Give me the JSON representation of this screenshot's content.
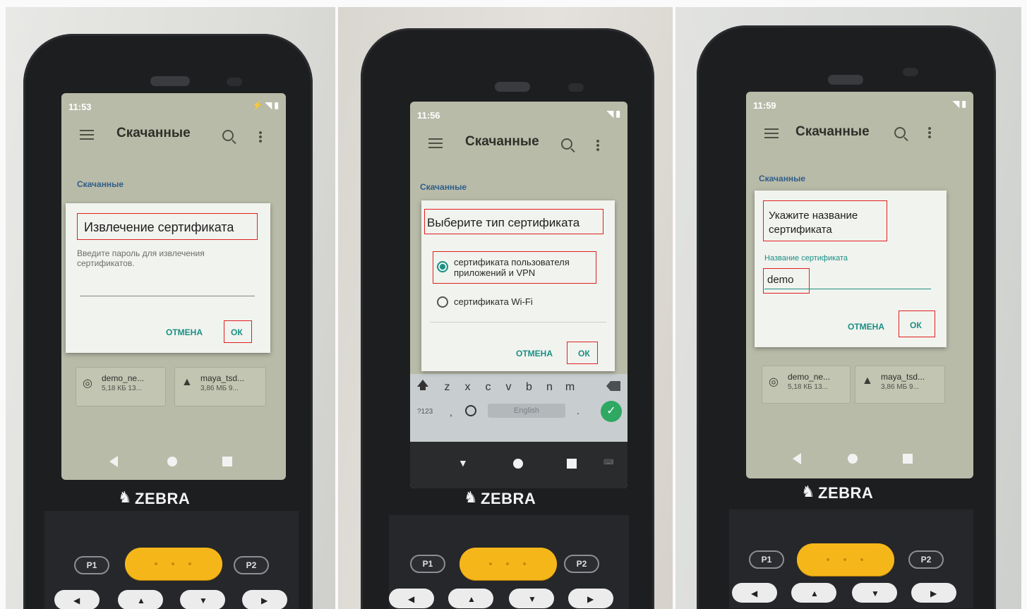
{
  "panels": [
    {
      "status_time": "11:53",
      "app_title": "Скачанные",
      "breadcrumb": "Скачанные",
      "dialog": {
        "title": "Извлечение сертификата",
        "message": "Введите пароль для извлечения сертификатов.",
        "cancel": "ОТМЕНА",
        "ok": "ОК"
      },
      "files": [
        {
          "name": "demo_ne...",
          "size": "5,18 КБ 13..."
        },
        {
          "name": "maya_tsd...",
          "size": "3,86 МБ 9..."
        }
      ],
      "logo": "ZEBRA"
    },
    {
      "status_time": "11:56",
      "app_title": "Скачанные",
      "breadcrumb": "Скачанные",
      "dialog": {
        "title": "Выберите тип сертификата",
        "option1": "сертификата пользователя приложений и VPN",
        "option2": "сертификата Wi-Fi",
        "cancel": "ОТМЕНА",
        "ok": "ОК"
      },
      "keyboard": {
        "row": [
          "z",
          "x",
          "c",
          "v",
          "b",
          "n",
          "m"
        ],
        "num_key": "?123",
        "comma": ",",
        "space_label": "English",
        "period": "."
      },
      "logo": "ZEBRA"
    },
    {
      "status_time": "11:59",
      "app_title": "Скачанные",
      "breadcrumb": "Скачанные",
      "dialog": {
        "title": "Укажите название сертификата",
        "field_label": "Название сертификата",
        "field_value": "demo",
        "cancel": "ОТМЕНА",
        "ok": "ОК"
      },
      "files": [
        {
          "name": "demo_ne...",
          "size": "5,18 КБ 13..."
        },
        {
          "name": "maya_tsd...",
          "size": "3,86 МБ 9..."
        }
      ],
      "logo": "ZEBRA"
    }
  ],
  "keypad": {
    "p1": "P1",
    "p2": "P2"
  },
  "colors": {
    "accent_teal": "#1a8f86",
    "highlight_red": "#e02020",
    "scan_yellow": "#f5b61a",
    "device_body": "#1d1e20"
  }
}
